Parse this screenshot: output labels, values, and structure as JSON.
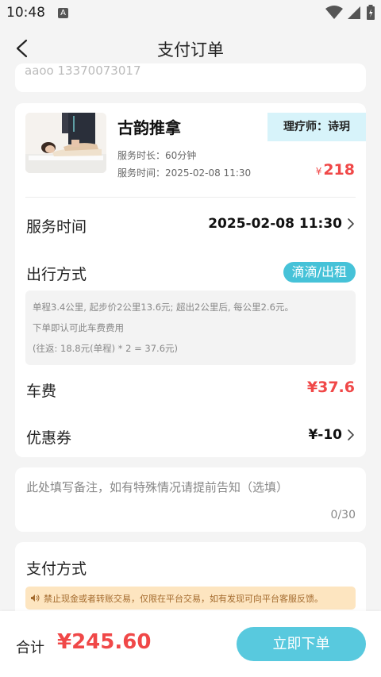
{
  "status_bar": {
    "time": "10:48",
    "notif_badge": "A"
  },
  "nav": {
    "title": "支付订单"
  },
  "address_card": {
    "partial_text": "aaoo      13370073017"
  },
  "service": {
    "name": "古韵推拿",
    "therapist_tag": "理疗师：诗玥",
    "duration": "服务时长：60分钟",
    "time": "服务时间：2025-02-08 11:30",
    "price_symbol": "¥",
    "price": "218"
  },
  "service_time_row": {
    "label": "服务时间",
    "value": "2025-02-08 11:30"
  },
  "travel_row": {
    "label": "出行方式",
    "option": "滴滴/出租"
  },
  "fare_info": {
    "line1": "单程3.4公里, 起步价2公里13.6元; 超出2公里后, 每公里2.6元。",
    "line2": "下单即认可此车费费用",
    "line3": "(往返: 18.8元(单程) * 2 = 37.6元)"
  },
  "car_fee_row": {
    "label": "车费",
    "value": "¥37.6"
  },
  "coupon_row": {
    "label": "优惠券",
    "value": "¥-10"
  },
  "note": {
    "placeholder": "此处填写备注，如有特殊情况请提前告知（选填）",
    "count": "0/30"
  },
  "payment": {
    "title": "支付方式",
    "warning": "禁止现金或者转账交易，仅限在平台交易，如有发现可向平台客服反馈。"
  },
  "bottom": {
    "total_label": "合计",
    "total_value": "¥245.60",
    "submit_label": "立即下单"
  },
  "colors": {
    "accent": "#58c9de",
    "price_red": "#f04848",
    "warning_bg": "#fde5c0",
    "tag_bg": "#d7f3fa"
  }
}
